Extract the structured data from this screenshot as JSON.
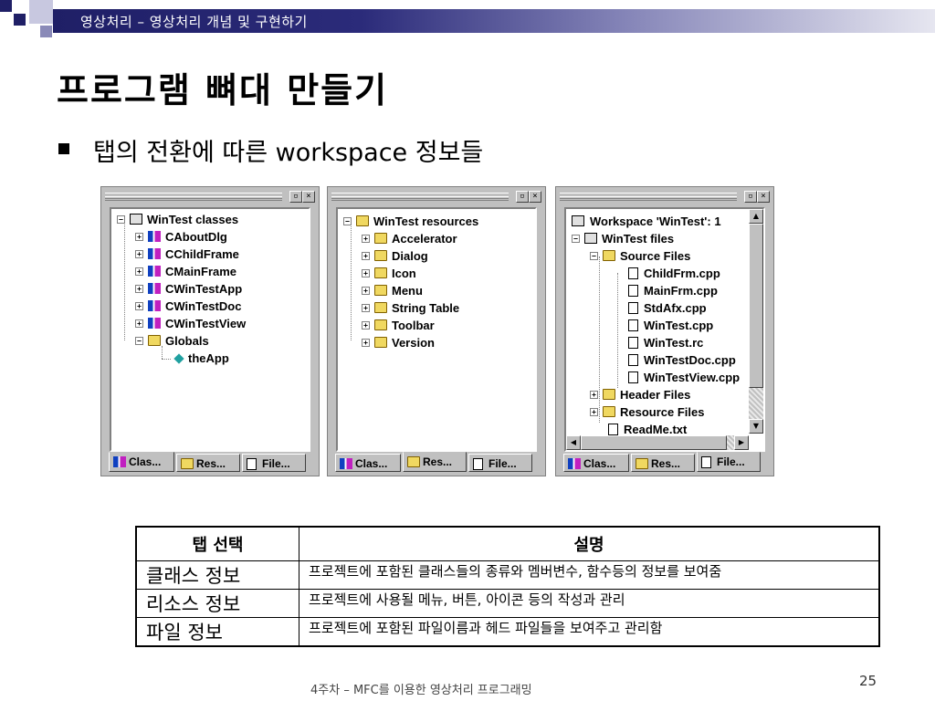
{
  "header": {
    "breadcrumb": "영상처리 – 영상처리 개념 및 구현하기"
  },
  "title": "프로그램 뼈대 만들기",
  "bullet": "탭의 전환에 따른 workspace 정보들",
  "panels": {
    "classes": {
      "root": "WinTest classes",
      "items": [
        "CAboutDlg",
        "CChildFrame",
        "CMainFrame",
        "CWinTestApp",
        "CWinTestDoc",
        "CWinTestView",
        "Globals",
        "theApp"
      ]
    },
    "resources": {
      "root": "WinTest resources",
      "items": [
        "Accelerator",
        "Dialog",
        "Icon",
        "Menu",
        "String Table",
        "Toolbar",
        "Version"
      ]
    },
    "files": {
      "workspace": "Workspace 'WinTest': 1",
      "project": "WinTest files",
      "source_folder": "Source Files",
      "source_files": [
        "ChildFrm.cpp",
        "MainFrm.cpp",
        "StdAfx.cpp",
        "WinTest.cpp",
        "WinTest.rc",
        "WinTestDoc.cpp",
        "WinTestView.cpp"
      ],
      "header_folder": "Header Files",
      "resource_folder": "Resource Files",
      "readme": "ReadMe.txt"
    },
    "tabs": [
      "Clas...",
      "Res...",
      "File..."
    ],
    "window_buttons": [
      "▫",
      "×"
    ]
  },
  "table": {
    "headers": [
      "탭 선택",
      "설명"
    ],
    "rows": [
      {
        "tab": "클래스 정보",
        "desc": "프로젝트에 포함된 클래스들의 종류와 멤버변수, 함수등의 정보를 보여줌"
      },
      {
        "tab": "리소스 정보",
        "desc": "프로젝트에 사용될 메뉴, 버튼, 아이콘 등의 작성과 관리"
      },
      {
        "tab": "파일 정보",
        "desc": "프로젝트에 포함된 파일이름과 헤드 파일들을 보여주고 관리함"
      }
    ]
  },
  "footer": "4주차 – MFC를 이용한 영상처리 프로그래밍",
  "page_number": "25",
  "colors": {
    "header_band": "#2b2b7a",
    "folder": "#f0d860",
    "panel_bg": "#c0c0c0"
  }
}
